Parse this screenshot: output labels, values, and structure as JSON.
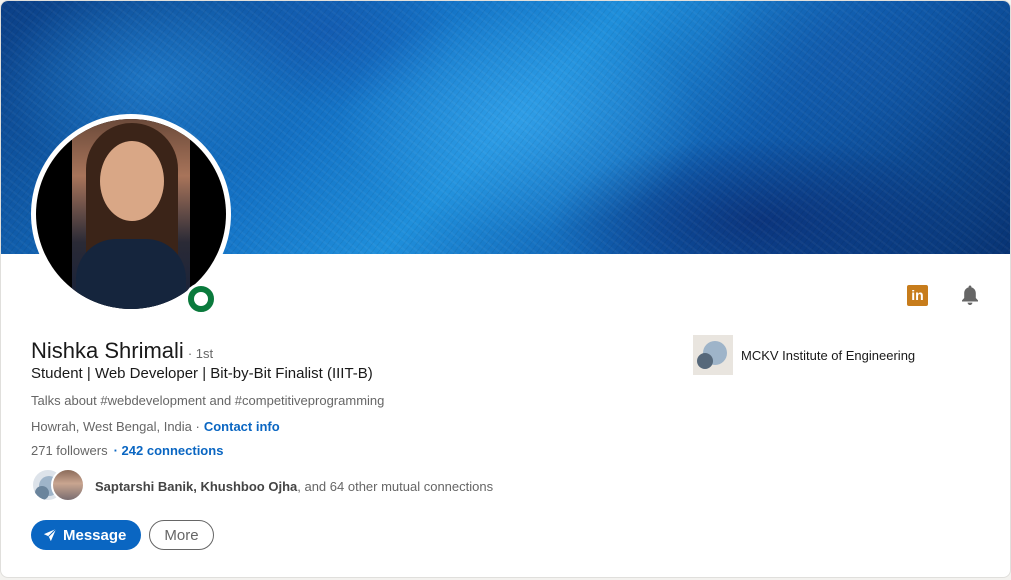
{
  "profile": {
    "name": "Nishka Shrimali",
    "degree": "· 1st",
    "headline": "Student | Web Developer | Bit-by-Bit Finalist (IIIT-B)",
    "talks_about": "Talks about #webdevelopment and #competitiveprogramming",
    "location": "Howrah, West Bengal, India ·",
    "contact_link": "Contact info",
    "followers": "271 followers",
    "connections": "· 242 connections",
    "online_status": "online",
    "status_color": "#0a7a3c"
  },
  "mutual": {
    "names": "Saptarshi Banik, Khushboo Ojha",
    "rest": ", and 64 other mutual connections"
  },
  "actions": {
    "message_label": "Message",
    "more_label": "More"
  },
  "icons": {
    "linkedin": "linkedin-icon",
    "linkedin_text": "in",
    "bell": "bell-icon",
    "send": "send-icon"
  },
  "organization": {
    "name": "MCKV Institute of Engineering"
  },
  "colors": {
    "accent": "#0a66c2",
    "linkedin_badge": "#c77c1b"
  }
}
